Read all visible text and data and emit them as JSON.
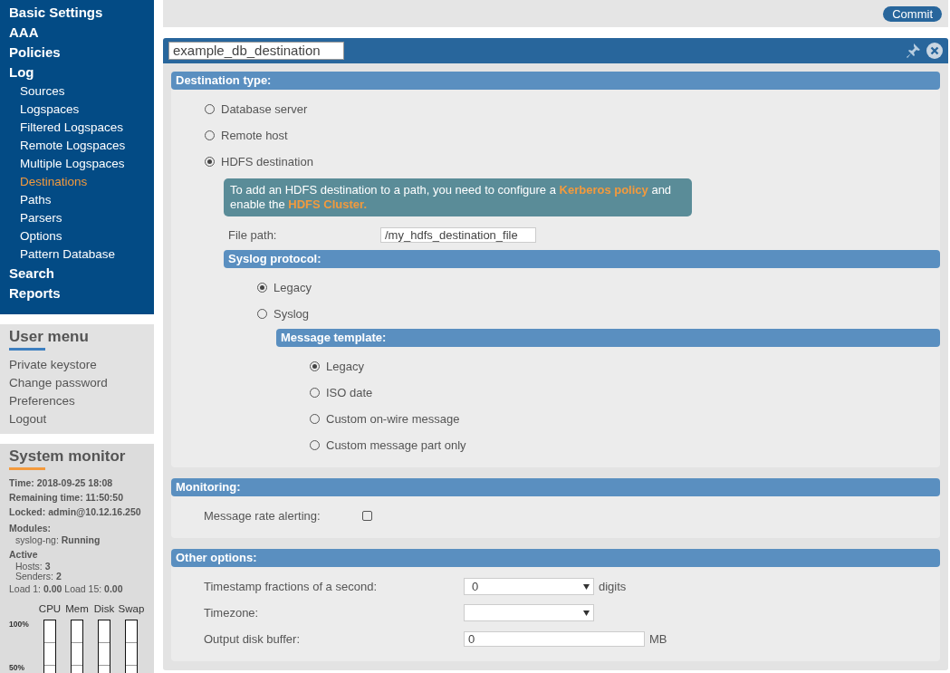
{
  "sidebar": {
    "nav": [
      {
        "label": "Basic Settings",
        "selected": false
      },
      {
        "label": "AAA",
        "selected": false
      },
      {
        "label": "Policies",
        "selected": false
      },
      {
        "label": "Log",
        "selected": false,
        "children": [
          {
            "label": "Sources",
            "selected": false
          },
          {
            "label": "Logspaces",
            "selected": false
          },
          {
            "label": "Filtered Logspaces",
            "selected": false
          },
          {
            "label": "Remote Logspaces",
            "selected": false
          },
          {
            "label": "Multiple Logspaces",
            "selected": false
          },
          {
            "label": "Destinations",
            "selected": true
          },
          {
            "label": "Paths",
            "selected": false
          },
          {
            "label": "Parsers",
            "selected": false
          },
          {
            "label": "Options",
            "selected": false
          },
          {
            "label": "Pattern Database",
            "selected": false
          }
        ]
      },
      {
        "label": "Search",
        "selected": false
      },
      {
        "label": "Reports",
        "selected": false
      }
    ],
    "user_menu": {
      "title": "User menu",
      "items": [
        "Private keystore",
        "Change password",
        "Preferences",
        "Logout"
      ]
    },
    "system_monitor": {
      "title": "System monitor",
      "lines": [
        {
          "kind": "bold",
          "text": "Time: 2018-09-25 18:08"
        },
        {
          "kind": "bold",
          "text": "Remaining time: 11:50:50"
        },
        {
          "kind": "bold",
          "text": "Locked: admin@10.12.16.250"
        },
        {
          "kind": "bold",
          "text": "Modules:"
        },
        {
          "kind": "indent",
          "text": "syslog-ng: **Running**"
        },
        {
          "kind": "bold",
          "text": "Active"
        },
        {
          "kind": "indent",
          "text": "Hosts: **3**"
        },
        {
          "kind": "indent",
          "text": "Senders: **2**"
        },
        {
          "kind": "plain",
          "text": "Load 1: **0.00** Load 15: **0.00**"
        }
      ],
      "gauges": [
        "CPU",
        "Mem",
        "Disk",
        "Swap"
      ],
      "gauge_ticks": [
        "100%",
        "50%"
      ]
    }
  },
  "main": {
    "commit_button": "Commit",
    "panel": {
      "name": "example_db_destination",
      "sections": [
        {
          "title": "Destination type:",
          "items": [
            {
              "kind": "radio",
              "label": "Database server",
              "selected": false
            },
            {
              "kind": "radio",
              "label": "Remote host",
              "selected": false
            },
            {
              "kind": "radio",
              "label": "HDFS destination",
              "selected": true
            },
            {
              "kind": "note",
              "parts": [
                {
                  "kind": "text",
                  "text": "To add an HDFS destination to a path, you need to configure a "
                },
                {
                  "kind": "link",
                  "text": "Kerberos policy"
                },
                {
                  "kind": "text",
                  "text": " and enable the "
                },
                {
                  "kind": "link",
                  "text": "HDFS Cluster."
                }
              ]
            },
            {
              "kind": "field",
              "label": "File path:",
              "value": "/my_hdfs_destination_file"
            },
            {
              "kind": "section",
              "title": "Syslog protocol:",
              "items": [
                {
                  "kind": "radio",
                  "label": "Legacy",
                  "selected": true
                },
                {
                  "kind": "radio",
                  "label": "Syslog",
                  "selected": false
                },
                {
                  "kind": "section",
                  "title": "Message template:",
                  "items": [
                    {
                      "kind": "radio",
                      "label": "Legacy",
                      "selected": true
                    },
                    {
                      "kind": "radio",
                      "label": "ISO date",
                      "selected": false
                    },
                    {
                      "kind": "radio",
                      "label": "Custom on-wire message",
                      "selected": false
                    },
                    {
                      "kind": "radio",
                      "label": "Custom message part only",
                      "selected": false
                    }
                  ]
                }
              ]
            }
          ]
        },
        {
          "title": "Monitoring:",
          "items": [
            {
              "kind": "checkbox",
              "label": "Message rate alerting:",
              "checked": false
            }
          ]
        },
        {
          "title": "Other options:",
          "items": [
            {
              "kind": "select",
              "label": "Timestamp fractions of a second:",
              "value": "0",
              "unit": "digits"
            },
            {
              "kind": "select",
              "label": "Timezone:"
            },
            {
              "kind": "field",
              "label": "Output disk buffer:",
              "value": "0",
              "unit": "MB"
            }
          ]
        }
      ]
    }
  }
}
